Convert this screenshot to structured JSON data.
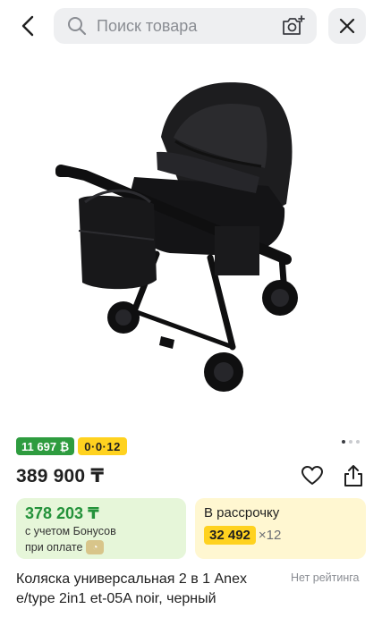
{
  "search": {
    "placeholder": "Поиск товара"
  },
  "icons": {
    "back": "chevron-left-icon",
    "search": "search-icon",
    "camera": "camera-search-icon",
    "close": "close-icon",
    "heart": "heart-icon",
    "share": "share-icon"
  },
  "product": {
    "image_alt": "stroller-image",
    "gallery_dots": 3,
    "gallery_active": 0,
    "badges": {
      "bonus": "11 697 ₿",
      "installment": "0·0·12"
    },
    "price": "389 900 ₸",
    "bonus_card": {
      "amount": "378 203 ₸",
      "line1": "с учетом Бонусов",
      "line2": "при оплате"
    },
    "installment_card": {
      "title": "В рассрочку",
      "monthly": "32 492",
      "months": "×12"
    },
    "title": "Коляска универсальная 2 в 1 Anex e/type 2in1 et-05A noir, черный",
    "rating": "Нет рейтинга"
  },
  "colors": {
    "green": "#2e9c3f",
    "yellow": "#ffd21f",
    "green_bg": "#e6f6d9",
    "yellow_bg": "#fff7d1"
  }
}
